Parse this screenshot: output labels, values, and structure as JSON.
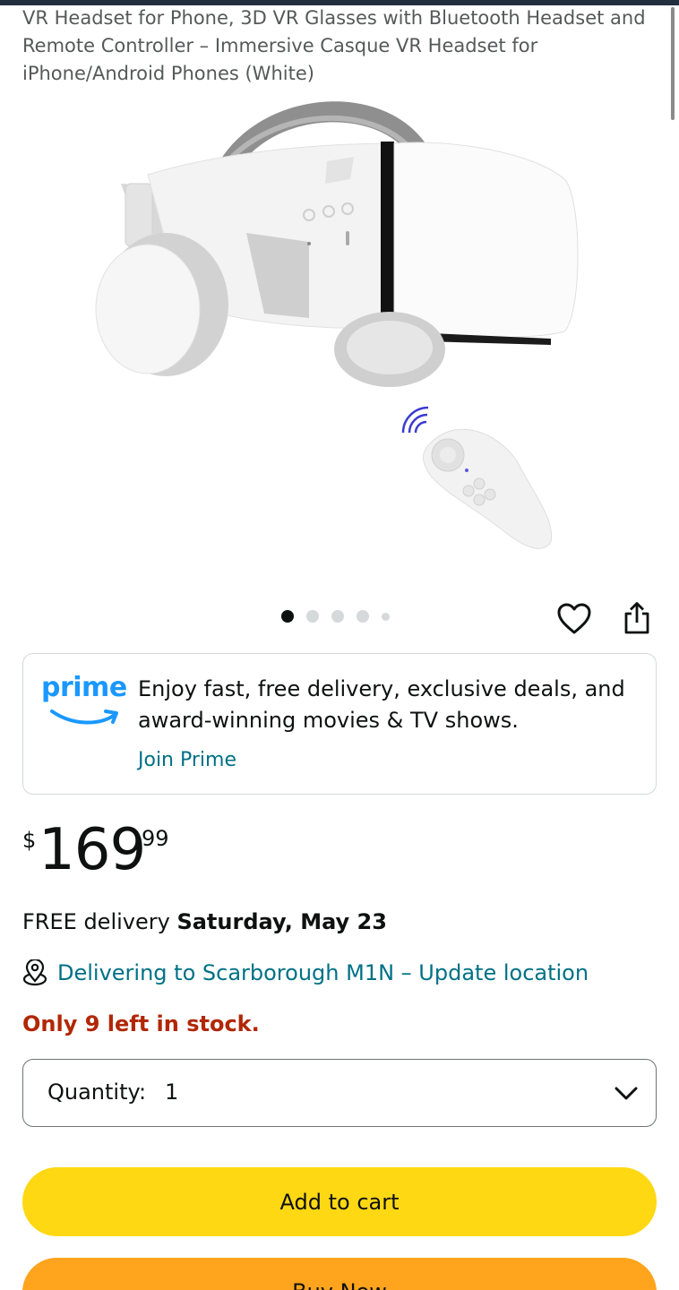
{
  "product": {
    "title": "VR Headset for Phone, 3D VR Glasses with Bluetooth Headset and Remote Controller – Immersive Casque VR Headset for iPhone/Android Phones (White)",
    "image_icon": "vr-headset-with-remote-controller",
    "image_count": 5,
    "active_image_index": 1
  },
  "actions": {
    "wishlist_icon": "heart-icon",
    "share_icon": "share-icon"
  },
  "prime": {
    "logo_text": "prime",
    "message": "Enjoy fast, free delivery, exclusive deals, and award-winning movies & TV shows.",
    "link": "Join Prime"
  },
  "price": {
    "symbol": "$",
    "whole": "169",
    "fraction": "99"
  },
  "delivery": {
    "prefix": "FREE delivery",
    "date": "Saturday, May 23",
    "location": "Delivering to Scarborough M1N – Update location"
  },
  "stock": "Only 9 left in stock.",
  "quantity": {
    "label": "Quantity:",
    "value": "1"
  },
  "buttons": {
    "add_to_cart": "Add to cart",
    "buy_now": "Buy Now"
  },
  "colors": {
    "add_to_cart": "#ffd814",
    "buy_now": "#ffa41c",
    "link": "#007185",
    "stock": "#b12704",
    "prime": "#1a98ff"
  }
}
